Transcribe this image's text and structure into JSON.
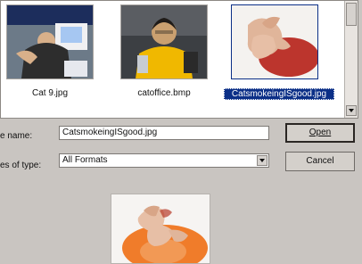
{
  "file_list": {
    "items": [
      {
        "name": "Cat 9.jpg"
      },
      {
        "name": "catoffice.bmp"
      },
      {
        "name": "CatsmokeingISgood.jpg",
        "selected": true
      }
    ]
  },
  "fields": {
    "file_name_label": "e name:",
    "file_name_value": "CatsmokeingISgood.jpg",
    "type_label": "es of type:",
    "type_value": "All Formats"
  },
  "buttons": {
    "open": "Open",
    "cancel": "Cancel"
  }
}
